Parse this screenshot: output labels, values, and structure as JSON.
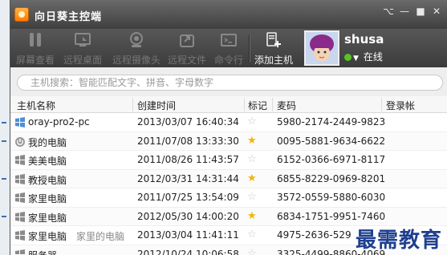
{
  "window": {
    "title": "向日葵主控端",
    "controls": [
      "⌥",
      "—",
      "■",
      "✕"
    ]
  },
  "toolbar": {
    "items": [
      {
        "label": "屏幕查看",
        "icon": "screen-view-icon"
      },
      {
        "label": "远程桌面",
        "icon": "remote-desktop-icon"
      },
      {
        "label": "远程摄像头",
        "icon": "remote-camera-icon"
      },
      {
        "label": "远程文件",
        "icon": "remote-file-icon"
      },
      {
        "label": "命令行",
        "icon": "command-line-icon"
      },
      {
        "label": "添加主机",
        "icon": "add-host-icon"
      }
    ]
  },
  "user": {
    "name": "shusa",
    "status": "在线",
    "status_color": "#58c322"
  },
  "search": {
    "placeholder": "主机搜索：智能匹配文字、拼音、字母数字"
  },
  "table": {
    "headers": {
      "name": "主机名称",
      "created": "创建时间",
      "tag": "标记",
      "code": "麦码",
      "login": "登录帐"
    },
    "rows": [
      {
        "icon": "windows-icon",
        "name": "oray-pro2-pc",
        "note": "",
        "created": "2013/03/07 16:40:34",
        "starred": false,
        "code": "5980-2174-2449-9823"
      },
      {
        "icon": "power-icon",
        "name": "我的电脑",
        "note": "",
        "created": "2011/07/08 13:33:30",
        "starred": true,
        "code": "0095-5881-9634-6622"
      },
      {
        "icon": "windows-icon",
        "name": "美美电脑",
        "note": "",
        "created": "2011/08/26 11:43:57",
        "starred": false,
        "code": "6152-0366-6971-8117"
      },
      {
        "icon": "windows-icon",
        "name": "教授电脑",
        "note": "",
        "created": "2012/03/31 14:31:44",
        "starred": true,
        "code": "6855-8229-0969-8201"
      },
      {
        "icon": "windows-icon",
        "name": "家里电脑",
        "note": "",
        "created": "2011/07/25 13:54:09",
        "starred": false,
        "code": "3572-0559-5880-6030"
      },
      {
        "icon": "windows-icon",
        "name": "家里电脑",
        "note": "",
        "created": "2012/05/30 14:00:20",
        "starred": true,
        "code": "6834-1751-9951-7460"
      },
      {
        "icon": "windows-icon",
        "name": "家里电脑",
        "note": "家里的电脑",
        "created": "2013/03/04 11:41:11",
        "starred": false,
        "code": "4975-2636-529"
      },
      {
        "icon": "windows-icon",
        "name": "服务器",
        "note": "",
        "created": "2012/10/24 10:06:58",
        "starred": false,
        "code": "3325-4499-8860-4069"
      }
    ]
  },
  "watermark": "最需教育"
}
